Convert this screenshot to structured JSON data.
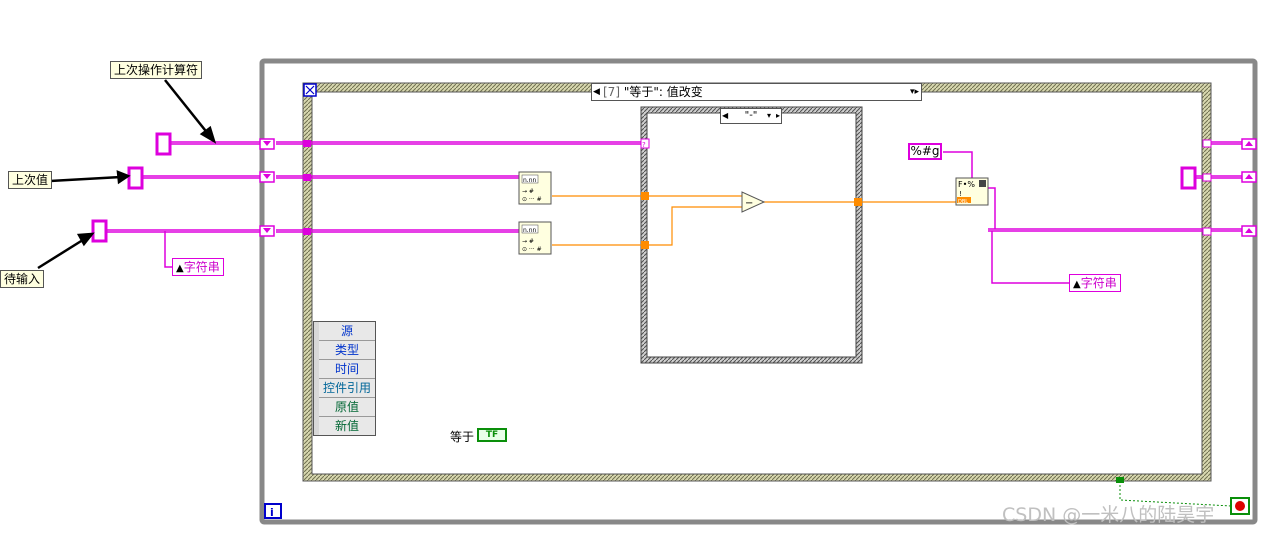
{
  "labels": {
    "last_operator": "上次操作计算符",
    "last_value": "上次值",
    "pending_input": "待输入"
  },
  "case_selector": {
    "index": "[7]",
    "text": "\"等于\": 值改变"
  },
  "inner_case_selector": {
    "text": "\"-\""
  },
  "event_data": {
    "items": [
      "源",
      "类型",
      "时间",
      "控件引用",
      "原值",
      "新值"
    ]
  },
  "string_ref_label": "字符串",
  "format_constant": "%#g",
  "equal_control": {
    "label": "等于",
    "indicator_text": "TF"
  },
  "loop_iteration_icon": "i",
  "watermark": "CSDN @一米八的陆昊宇",
  "icons": {
    "stop_button": "stop-icon",
    "num_to_string": "number-to-string-icon",
    "format_into_string": "format-into-string-icon",
    "subtract": "subtract-icon",
    "shift_register": "shift-register-icon"
  },
  "colors": {
    "string_wire": "#dd00dd",
    "numeric_wire": "#ff8c00",
    "bool_wire": "#0a8f0a",
    "structure_border": "#888888"
  }
}
